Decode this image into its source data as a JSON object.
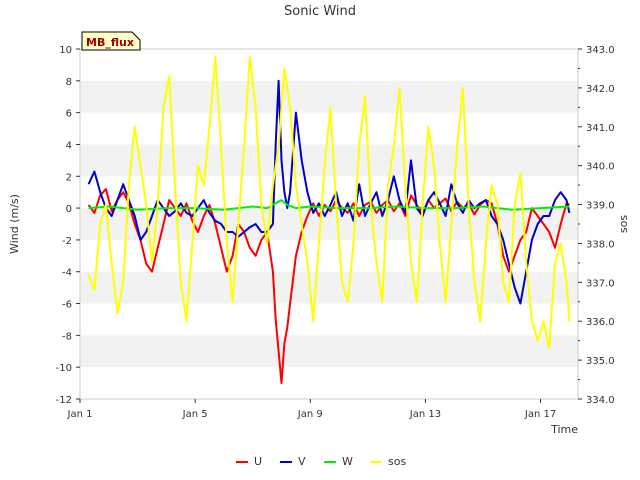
{
  "chart_data": {
    "type": "line",
    "title": "Sonic Wind",
    "site_label": "MB_flux",
    "xlabel": "Time",
    "ylabel_left": "Wind (m/s)",
    "ylabel_right": "sos",
    "xlim": [
      1.0,
      18.3
    ],
    "ylim_left": [
      -12,
      10
    ],
    "ylim_right": [
      334.0,
      343.0
    ],
    "grid_bands": true,
    "legend_placement": "bottom-center",
    "x_ticks": [
      {
        "value": 1,
        "label": "Jan 1"
      },
      {
        "value": 5,
        "label": "Jan 5"
      },
      {
        "value": 9,
        "label": "Jan 9"
      },
      {
        "value": 13,
        "label": "Jan 13"
      },
      {
        "value": 17,
        "label": "Jan 17"
      }
    ],
    "y_ticks_left": [
      10,
      8,
      6,
      4,
      2,
      0,
      -2,
      -4,
      -6,
      -8,
      -10,
      -12
    ],
    "y_ticks_right": [
      343.0,
      342.0,
      341.0,
      340.0,
      339.0,
      338.0,
      337.0,
      336.0,
      335.0,
      334.0
    ],
    "series": [
      {
        "name": "U",
        "color": "#ff0000",
        "axis": "left",
        "x": [
          1.3,
          1.5,
          1.7,
          1.9,
          2.1,
          2.3,
          2.5,
          2.7,
          2.9,
          3.1,
          3.3,
          3.5,
          3.7,
          3.9,
          4.1,
          4.3,
          4.5,
          4.7,
          4.9,
          5.1,
          5.3,
          5.5,
          5.7,
          5.9,
          6.1,
          6.3,
          6.5,
          6.7,
          6.9,
          7.1,
          7.3,
          7.5,
          7.7,
          7.8,
          7.9,
          8.0,
          8.1,
          8.2,
          8.3,
          8.5,
          8.7,
          8.9,
          9.1,
          9.3,
          9.5,
          9.7,
          9.9,
          10.1,
          10.3,
          10.5,
          10.7,
          10.9,
          11.1,
          11.3,
          11.5,
          11.7,
          11.9,
          12.1,
          12.3,
          12.5,
          12.7,
          12.9,
          13.1,
          13.3,
          13.5,
          13.7,
          13.9,
          14.1,
          14.3,
          14.5,
          14.7,
          14.9,
          15.1,
          15.3,
          15.5,
          15.7,
          15.9,
          16.1,
          16.3,
          16.5,
          16.7,
          16.9,
          17.1,
          17.3,
          17.5,
          17.7,
          17.9,
          18.0
        ],
        "y": [
          0.2,
          -0.3,
          0.8,
          1.2,
          -0.2,
          0.5,
          1.0,
          0.3,
          -1.0,
          -2.0,
          -3.5,
          -4.0,
          -2.5,
          -1.0,
          0.5,
          0.0,
          -0.5,
          0.3,
          -0.8,
          -1.5,
          -0.5,
          0.2,
          -1.0,
          -2.5,
          -4.0,
          -3.0,
          -1.0,
          -1.5,
          -2.5,
          -3.0,
          -2.0,
          -1.5,
          -4.0,
          -7.0,
          -9.0,
          -11.0,
          -8.5,
          -7.5,
          -6.0,
          -3.0,
          -1.5,
          -0.5,
          0.3,
          -0.5,
          0.2,
          -0.2,
          0.5,
          0.0,
          -0.3,
          0.3,
          -0.5,
          0.2,
          0.4,
          -0.3,
          0.2,
          0.5,
          -0.2,
          0.3,
          -0.5,
          0.8,
          0.2,
          -0.3,
          0.5,
          0.0,
          0.3,
          0.6,
          -0.2,
          0.4,
          0.0,
          0.3,
          -0.4,
          0.2,
          0.5,
          0.3,
          -1.0,
          -3.0,
          -4.0,
          -3.0,
          -2.0,
          -1.5,
          0.0,
          -0.5,
          -1.0,
          -1.5,
          -2.5,
          -1.0,
          0.3,
          0.2
        ]
      },
      {
        "name": "V",
        "color": "#0000cc",
        "axis": "left",
        "x": [
          1.3,
          1.5,
          1.7,
          1.9,
          2.1,
          2.3,
          2.5,
          2.7,
          2.9,
          3.1,
          3.3,
          3.5,
          3.7,
          3.9,
          4.1,
          4.3,
          4.5,
          4.7,
          4.9,
          5.1,
          5.3,
          5.5,
          5.7,
          5.9,
          6.1,
          6.3,
          6.5,
          6.7,
          6.9,
          7.1,
          7.3,
          7.5,
          7.7,
          7.8,
          7.9,
          8.0,
          8.1,
          8.2,
          8.3,
          8.5,
          8.7,
          8.9,
          9.1,
          9.3,
          9.5,
          9.7,
          9.9,
          10.1,
          10.3,
          10.5,
          10.7,
          10.9,
          11.1,
          11.3,
          11.5,
          11.7,
          11.9,
          12.1,
          12.3,
          12.5,
          12.7,
          12.9,
          13.1,
          13.3,
          13.5,
          13.7,
          13.9,
          14.1,
          14.3,
          14.5,
          14.7,
          14.9,
          15.1,
          15.3,
          15.5,
          15.7,
          15.9,
          16.1,
          16.3,
          16.5,
          16.7,
          16.9,
          17.1,
          17.3,
          17.5,
          17.7,
          17.9,
          18.0
        ],
        "y": [
          1.5,
          2.3,
          1.0,
          0.0,
          -0.5,
          0.5,
          1.5,
          0.5,
          -0.5,
          -2.0,
          -1.5,
          -0.5,
          0.5,
          0.0,
          -0.5,
          -0.2,
          0.3,
          -0.3,
          -0.5,
          0.0,
          0.5,
          -0.3,
          -0.8,
          -1.0,
          -1.5,
          -1.5,
          -1.8,
          -1.5,
          -1.2,
          -1.0,
          -1.5,
          -1.5,
          -1.0,
          4.0,
          8.0,
          3.0,
          1.0,
          0.0,
          1.0,
          6.0,
          3.0,
          1.0,
          -0.3,
          0.3,
          -0.5,
          0.2,
          1.0,
          -0.5,
          0.3,
          -0.8,
          1.5,
          -0.5,
          0.3,
          1.0,
          -0.5,
          0.5,
          2.0,
          0.5,
          -0.3,
          3.0,
          0.0,
          -0.5,
          0.5,
          1.0,
          0.3,
          -0.5,
          1.5,
          0.3,
          -0.3,
          0.5,
          0.0,
          0.3,
          0.5,
          -0.5,
          -1.0,
          -2.0,
          -3.5,
          -5.0,
          -6.0,
          -4.0,
          -2.0,
          -1.0,
          -0.5,
          -0.5,
          0.5,
          1.0,
          0.5,
          -0.3
        ]
      },
      {
        "name": "W",
        "color": "#00ee00",
        "axis": "left",
        "x": [
          1.3,
          2.0,
          3.0,
          4.0,
          5.0,
          6.0,
          7.0,
          7.5,
          7.8,
          8.0,
          8.2,
          8.5,
          9.0,
          10.0,
          11.0,
          12.0,
          13.0,
          14.0,
          15.0,
          16.0,
          17.0,
          18.0
        ],
        "y": [
          0.0,
          0.1,
          -0.1,
          0.0,
          0.0,
          -0.1,
          0.1,
          0.0,
          0.3,
          0.5,
          0.2,
          0.0,
          0.1,
          0.0,
          0.0,
          0.1,
          0.0,
          0.0,
          0.1,
          -0.1,
          0.0,
          0.1
        ]
      },
      {
        "name": "sos",
        "color": "#ffff00",
        "axis": "right",
        "x": [
          1.3,
          1.5,
          1.7,
          1.9,
          2.1,
          2.3,
          2.5,
          2.7,
          2.9,
          3.1,
          3.3,
          3.5,
          3.7,
          3.9,
          4.1,
          4.3,
          4.5,
          4.7,
          4.9,
          5.1,
          5.3,
          5.5,
          5.7,
          5.9,
          6.1,
          6.3,
          6.5,
          6.7,
          6.9,
          7.1,
          7.3,
          7.5,
          7.7,
          7.9,
          8.1,
          8.3,
          8.5,
          8.7,
          8.9,
          9.1,
          9.3,
          9.5,
          9.7,
          9.9,
          10.1,
          10.3,
          10.5,
          10.7,
          10.9,
          11.1,
          11.3,
          11.5,
          11.7,
          11.9,
          12.1,
          12.3,
          12.5,
          12.7,
          12.9,
          13.1,
          13.3,
          13.5,
          13.7,
          13.9,
          14.1,
          14.3,
          14.5,
          14.7,
          14.9,
          15.1,
          15.3,
          15.5,
          15.7,
          15.9,
          16.1,
          16.3,
          16.5,
          16.7,
          16.9,
          17.1,
          17.3,
          17.5,
          17.7,
          17.9,
          18.0
        ],
        "y": [
          337.2,
          336.8,
          338.5,
          339.0,
          337.5,
          336.2,
          337.0,
          339.5,
          341.0,
          340.0,
          339.0,
          337.5,
          339.0,
          341.5,
          342.3,
          339.5,
          337.0,
          336.0,
          338.0,
          340.0,
          339.5,
          341.0,
          342.8,
          340.5,
          338.0,
          336.5,
          338.5,
          340.5,
          342.8,
          341.5,
          339.0,
          338.0,
          339.5,
          340.5,
          342.5,
          341.5,
          339.5,
          338.5,
          337.5,
          336.0,
          338.0,
          340.0,
          341.5,
          339.0,
          337.0,
          336.5,
          338.0,
          340.5,
          341.8,
          339.0,
          337.5,
          336.5,
          339.5,
          340.5,
          342.0,
          339.5,
          337.5,
          336.5,
          339.0,
          341.0,
          340.0,
          338.0,
          336.5,
          338.5,
          340.5,
          342.0,
          339.0,
          337.0,
          336.0,
          338.0,
          339.5,
          339.0,
          337.0,
          336.5,
          339.0,
          339.8,
          337.5,
          336.0,
          335.5,
          336.0,
          335.3,
          337.5,
          338.0,
          337.0,
          336.0
        ]
      }
    ]
  }
}
